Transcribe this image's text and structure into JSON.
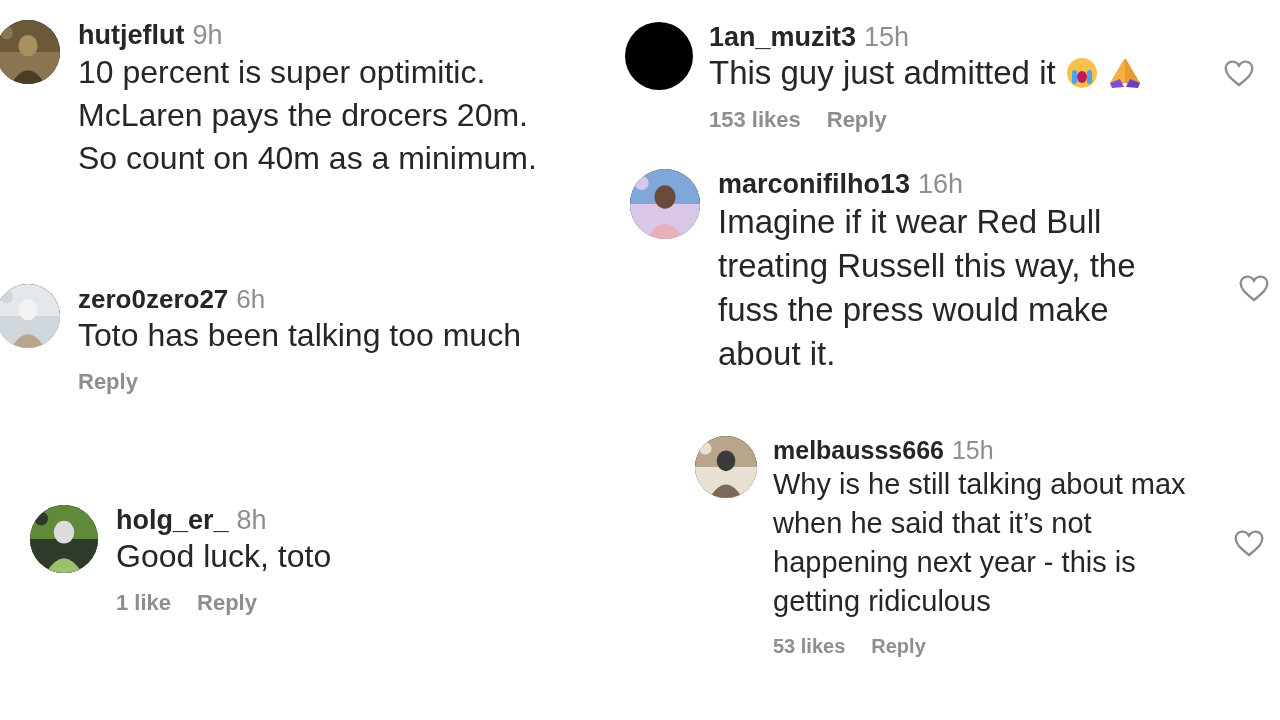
{
  "columns": [
    {
      "comments": [
        {
          "user": "hutjeflut",
          "time": "9h",
          "text": "10 percent is super optimitic. McLaren pays the drocers 20m. So count on 40m as a minimum."
        },
        {
          "user": "zero0zero27",
          "time": "6h",
          "text": "Toto has been talking too much",
          "reply": "Reply"
        },
        {
          "user": "holg_er_",
          "time": "8h",
          "text": "Good luck, toto",
          "likes": "1 like",
          "reply": "Reply"
        }
      ]
    },
    {
      "comments": [
        {
          "avatar": {
            "kind": "blank"
          },
          "user": "1an_muzit3",
          "time": "15h",
          "text": "This guy just admitted it",
          "emoji": [
            {
              "kind": "crying"
            },
            {
              "kind": "praying"
            }
          ],
          "likes": "153 likes",
          "reply": "Reply",
          "liked": false
        },
        {
          "user": "marconifilho13",
          "time": "16h",
          "text": "Imagine if it wear Red Bull treating Russell this way, the fuss the press would make about it.",
          "liked": false
        },
        {
          "user": "melbausss666",
          "time": "15h",
          "text": "Why is he still talking about max when he said that it’s not happening next year - this is getting ridiculous",
          "likes": "53 likes",
          "reply": "Reply",
          "liked": false
        }
      ]
    }
  ]
}
